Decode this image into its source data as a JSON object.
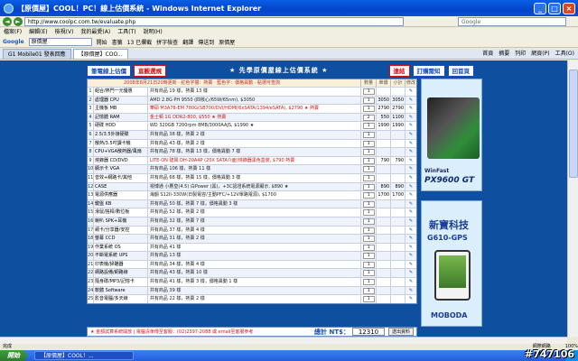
{
  "window": {
    "title": "【原價屋】COOL！PC！線上估價系統 - Windows Internet Explorer",
    "min": "_",
    "max": "□",
    "close": "×"
  },
  "address": {
    "url": "http://www.coolpc.com.tw/evaluate.php",
    "search_placeholder": "Google"
  },
  "menu": [
    "檔案(F)",
    "編輯(E)",
    "檢視(V)",
    "我的最愛(A)",
    "工具(T)",
    "說明(H)"
  ],
  "google_toolbar": {
    "logo": "Google",
    "query": "原價屋",
    "buttons": [
      "開始",
      "書籤",
      "13 已攔截",
      "拼字檢查",
      "翻譯",
      "傳送到",
      "原價屋"
    ]
  },
  "tabs": [
    "G1 Mobile01 發表回應",
    "【原價屋】COO..."
  ],
  "commands": [
    "首頁",
    "摘要",
    "列印",
    "網頁(P)",
    "工具(O)"
  ],
  "site": {
    "btn_assess": "筆電線上估價",
    "btn_display": "直觀選規",
    "title": "★ 先學原價屋線上估價系統 ★",
    "btn_contact": "連結",
    "btn_order": "訂購需知",
    "btn_catalog": "回首頁"
  },
  "table": {
    "info": "2008年8月21日20時更新 · 紅色字體：熱賣 · 藍色字：價格異動 · 點選可查詢",
    "headers": {
      "qty": "數量",
      "price": "單價",
      "sub": "小計",
      "edit": "修改"
    },
    "rows": [
      {
        "no": "1",
        "cat": "組合/熱門一元優惠",
        "item": "共有商品 19 樣，熱賣 13 樣",
        "qty": "1",
        "price": "",
        "sub": "",
        "hi": false
      },
      {
        "no": "2",
        "cat": "處理器 CPU",
        "item": "AMD 2.8G PH 9550 (四核心/65W/65nm), $3050",
        "qty": "1",
        "price": "3050",
        "sub": "3050",
        "hi": false
      },
      {
        "no": "3",
        "cat": "主機板 MB",
        "item": "華碩 M3A78-EM 780G(SB700/DVI/HDMI/6xSATA/1394/eSATA), $2790 ★ 熱賣",
        "qty": "1",
        "price": "2790",
        "sub": "2790",
        "hi": true
      },
      {
        "no": "4",
        "cat": "記憶體 RAM",
        "item": "金士頓 1G DDR2-800, $550 ★ 熱賣",
        "qty": "2",
        "price": "550",
        "sub": "1100",
        "hi": true
      },
      {
        "no": "5",
        "cat": "硬碟 HDD",
        "item": "WD 320GB 7200rpm 8MB/3000AAJS, $1990 ★",
        "qty": "1",
        "price": "1990",
        "sub": "1990",
        "hi": false
      },
      {
        "no": "6",
        "cat": "2.5/3.5外接硬碟",
        "item": "共有商品 38 樣，熱賣 2 樣",
        "qty": "1",
        "price": "",
        "sub": "",
        "hi": false
      },
      {
        "no": "7",
        "cat": "散熱/3.5吋讀卡機",
        "item": "共有商品 43 樣，熱賣 2 樣",
        "qty": "1",
        "price": "",
        "sub": "",
        "hi": false
      },
      {
        "no": "8",
        "cat": "CPU+VGA散熱器/風扇",
        "item": "共有商品 78 樣，熱賣 13 樣，價格異動 7 樣",
        "qty": "1",
        "price": "",
        "sub": "",
        "hi": false
      },
      {
        "no": "9",
        "cat": "燒錄器 CD/DVD",
        "item": "LITE-ON 建興 DH-20A4P (20X SATA介面)燒錄器黑色盒裝, $790 熱賣",
        "qty": "1",
        "price": "790",
        "sub": "790",
        "hi": true
      },
      {
        "no": "10",
        "cat": "顯示卡 VGA",
        "item": "共有商品 106 樣，熱賣 11 樣",
        "qty": "1",
        "price": "",
        "sub": "",
        "hi": false
      },
      {
        "no": "11",
        "cat": "音效+網路卡/其他",
        "item": "共有商品 68 樣，熱賣 15 樣，價格異動 3 樣",
        "qty": "1",
        "price": "",
        "sub": "",
        "hi": false
      },
      {
        "no": "12",
        "cat": "CASE",
        "item": "視博通 小鷹皇(4.5) 白Power (黑)，+3C認證系統電源顯示, $890 ★",
        "qty": "1",
        "price": "890",
        "sub": "890",
        "hi": false
      },
      {
        "no": "13",
        "cat": "電源供應器",
        "item": "海韻 S12II-330W(日製電容/主動PFC/+12V單路電源), $1700",
        "qty": "1",
        "price": "1700",
        "sub": "1700",
        "hi": false
      },
      {
        "no": "14",
        "cat": "鍵盤 KB",
        "item": "共有商品 50 樣，熱賣 7 樣，價格異動 3 樣",
        "qty": "1",
        "price": "",
        "sub": "",
        "hi": false
      },
      {
        "no": "15",
        "cat": "滑鼠/搖桿/數位板",
        "item": "共有商品 52 樣，熱賣 2 樣",
        "qty": "1",
        "price": "",
        "sub": "",
        "hi": false
      },
      {
        "no": "16",
        "cat": "喇叭 SPK+耳機",
        "item": "共有商品 32 樣，熱賣 7 樣",
        "qty": "1",
        "price": "",
        "sub": "",
        "hi": false
      },
      {
        "no": "17",
        "cat": "網卡/分享器/安控",
        "item": "共有商品 37 樣，熱賣 4 樣",
        "qty": "1",
        "price": "",
        "sub": "",
        "hi": false
      },
      {
        "no": "18",
        "cat": "螢幕 CCD",
        "item": "共有商品 31 樣，熱賣 2 樣",
        "qty": "1",
        "price": "",
        "sub": "",
        "hi": false
      },
      {
        "no": "19",
        "cat": "作業系統 OS",
        "item": "共有商品 41 樣",
        "qty": "1",
        "price": "",
        "sub": "",
        "hi": false
      },
      {
        "no": "20",
        "cat": "不斷電系統 UPS",
        "item": "共有商品 13 樣",
        "qty": "1",
        "price": "",
        "sub": "",
        "hi": false
      },
      {
        "no": "21",
        "cat": "印表機/掃瞄器",
        "item": "共有商品 34 樣，熱賣 4 樣",
        "qty": "1",
        "price": "",
        "sub": "",
        "hi": false
      },
      {
        "no": "22",
        "cat": "網路設備/網路線",
        "item": "共有商品 43 樣，熱賣 10 樣",
        "qty": "1",
        "price": "",
        "sub": "",
        "hi": false
      },
      {
        "no": "23",
        "cat": "隨身碟/MP3/記憶卡",
        "item": "共有商品 41 樣，熱賣 3 樣，價格異動 1 樣",
        "qty": "1",
        "price": "",
        "sub": "",
        "hi": false
      },
      {
        "no": "24",
        "cat": "軟體 Software",
        "item": "共有商品 39 樣",
        "qty": "1",
        "price": "",
        "sub": "",
        "hi": false
      },
      {
        "no": "25",
        "cat": "影音電腦/多天線",
        "item": "共有商品 22 樣，熱賣 2 樣",
        "qty": "1",
        "price": "",
        "sub": "",
        "hi": false
      }
    ],
    "footer_note": "★ 金額試算系統開放 | 電腦清單傳至客服：(02)2397-2088 或 email至客服參考",
    "total_label": "總計 NT$：",
    "total": "12310",
    "send": "送出資料"
  },
  "ads": {
    "ad1_brand": "WinFast",
    "ad1_model": "PX9600 GT",
    "ad2_brand": "新寶科技",
    "ad2_model": "G610-GPS",
    "ad2_foot": "MOBODA"
  },
  "status": {
    "left": "完成",
    "zone": "網際網路",
    "zoom": "100%"
  },
  "taskbar": {
    "start": "開始",
    "task": "【原價屋】COOL！...",
    "watermark": "#747106"
  }
}
